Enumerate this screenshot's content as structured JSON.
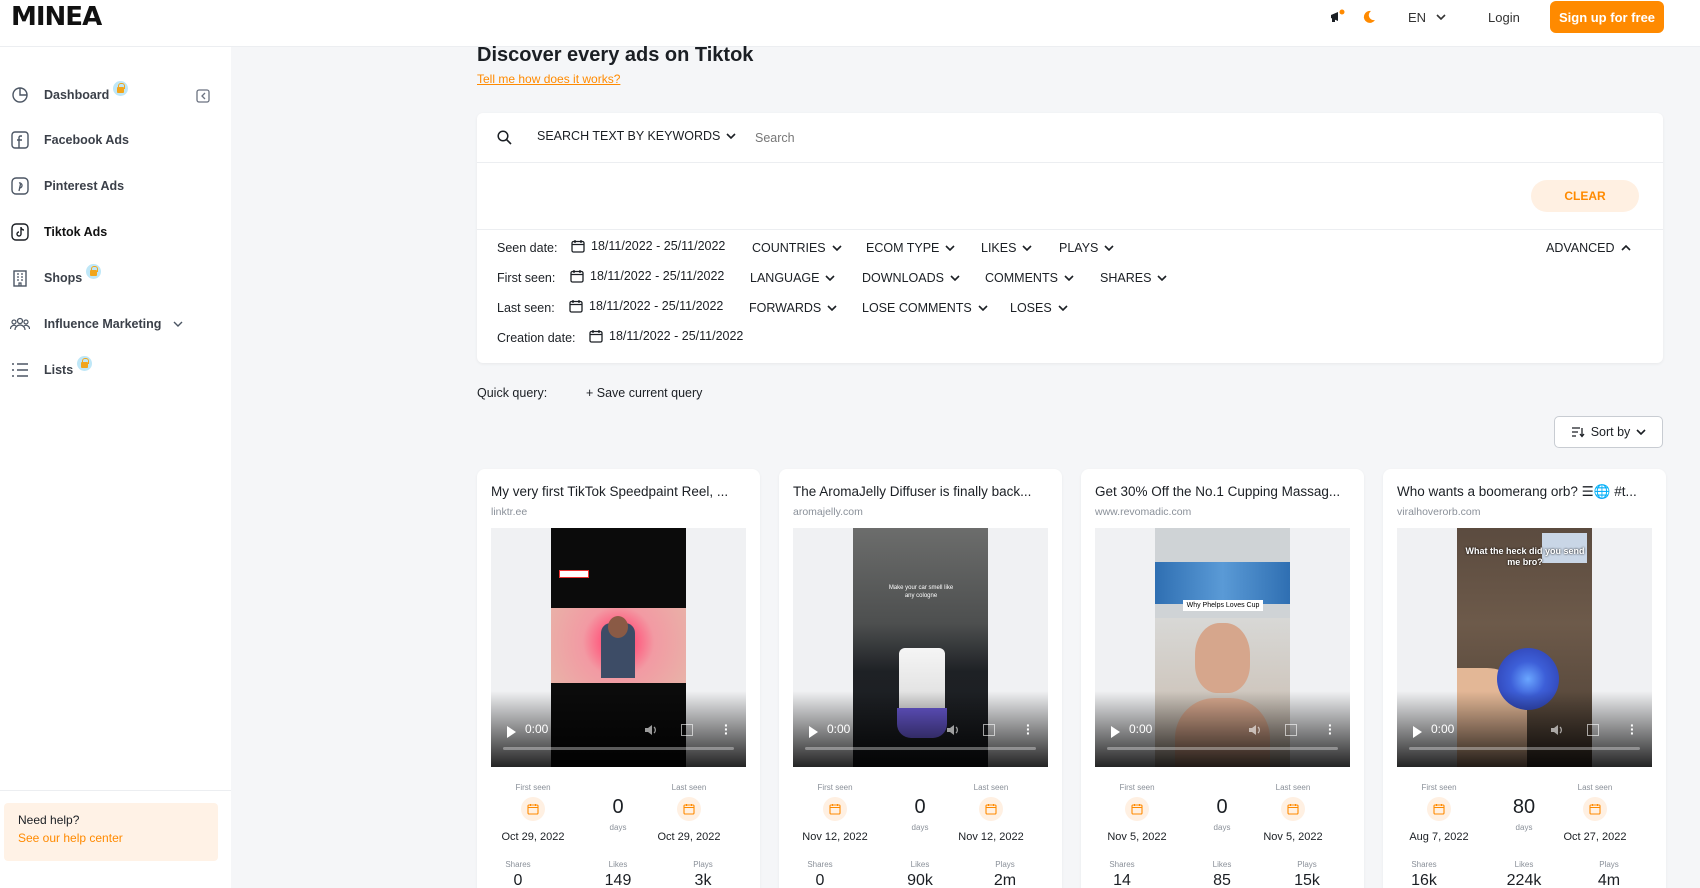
{
  "brand": {
    "logo_text": "MINEA",
    "accent": "#ff8a00"
  },
  "topbar": {
    "language": "EN",
    "login": "Login",
    "signup": "Sign up for free"
  },
  "sidebar": {
    "items": [
      {
        "label": "Dashboard",
        "icon": "pie-chart-icon",
        "locked": true
      },
      {
        "label": "Facebook Ads",
        "icon": "facebook-icon",
        "locked": false
      },
      {
        "label": "Pinterest Ads",
        "icon": "pinterest-icon",
        "locked": false
      },
      {
        "label": "Tiktok Ads",
        "icon": "tiktok-icon",
        "locked": false,
        "active": true
      },
      {
        "label": "Shops",
        "icon": "building-icon",
        "locked": true
      },
      {
        "label": "Influence Marketing",
        "icon": "people-icon",
        "locked": false,
        "expandable": true
      },
      {
        "label": "Lists",
        "icon": "list-icon",
        "locked": true
      }
    ],
    "help": {
      "title": "Need help?",
      "link": "See our help center"
    }
  },
  "main": {
    "title": "Discover every ads on Tiktok",
    "how_link": "Tell me how does it works?",
    "search": {
      "mode": "SEARCH TEXT BY KEYWORDS",
      "placeholder": "Search",
      "clear": "CLEAR"
    },
    "filters": {
      "seen_date": {
        "label": "Seen date:",
        "value": "18/11/2022 - 25/11/2022"
      },
      "first_seen": {
        "label": "First seen:",
        "value": "18/11/2022 - 25/11/2022"
      },
      "last_seen": {
        "label": "Last seen:",
        "value": "18/11/2022 - 25/11/2022"
      },
      "creation_date": {
        "label": "Creation date:",
        "value": "18/11/2022 - 25/11/2022"
      },
      "dropdowns": {
        "countries": "COUNTRIES",
        "ecom_type": "ECOM TYPE",
        "likes": "LIKES",
        "plays": "PLAYS",
        "language": "LANGUAGE",
        "downloads": "DOWNLOADS",
        "comments": "COMMENTS",
        "shares": "SHARES",
        "forwards": "FORWARDS",
        "lose_comments": "LOSE COMMENTS",
        "loses": "LOSES",
        "advanced": "ADVANCED"
      }
    },
    "quick_query": {
      "label": "Quick query:",
      "save": "+ Save current query"
    },
    "sort": "Sort by",
    "stat_labels": {
      "first_seen": "First seen",
      "last_seen": "Last seen",
      "days": "days",
      "shares": "Shares",
      "likes": "Likes",
      "plays": "Plays"
    },
    "cards": [
      {
        "title": "My very first TikTok Speedpaint Reel, ...",
        "domain": "linktr.ee",
        "time": "0:00",
        "first_seen": "Oct 29, 2022",
        "last_seen": "Oct 29, 2022",
        "days": "0",
        "shares": "0",
        "likes": "149",
        "plays": "3k"
      },
      {
        "title": "The AromaJelly Diffuser is finally back...",
        "domain": "aromajelly.com",
        "time": "0:00",
        "first_seen": "Nov 12, 2022",
        "last_seen": "Nov 12, 2022",
        "days": "0",
        "shares": "0",
        "likes": "90k",
        "plays": "2m"
      },
      {
        "title": "Get 30% Off the No.1 Cupping Massag...",
        "domain": "www.revomadic.com",
        "time": "0:00",
        "first_seen": "Nov 5, 2022",
        "last_seen": "Nov 5, 2022",
        "days": "0",
        "shares": "14",
        "likes": "85",
        "plays": "15k",
        "overlay": "Why Phelps Loves Cup"
      },
      {
        "title": "Who wants a boomerang orb? ☰🌐 #t...",
        "domain": "viralhoverorb.com",
        "time": "0:00",
        "first_seen": "Aug 7, 2022",
        "last_seen": "Oct 27, 2022",
        "days": "80",
        "shares": "16k",
        "likes": "224k",
        "plays": "4m",
        "overlay": "What the heck did you send me bro?"
      }
    ]
  }
}
